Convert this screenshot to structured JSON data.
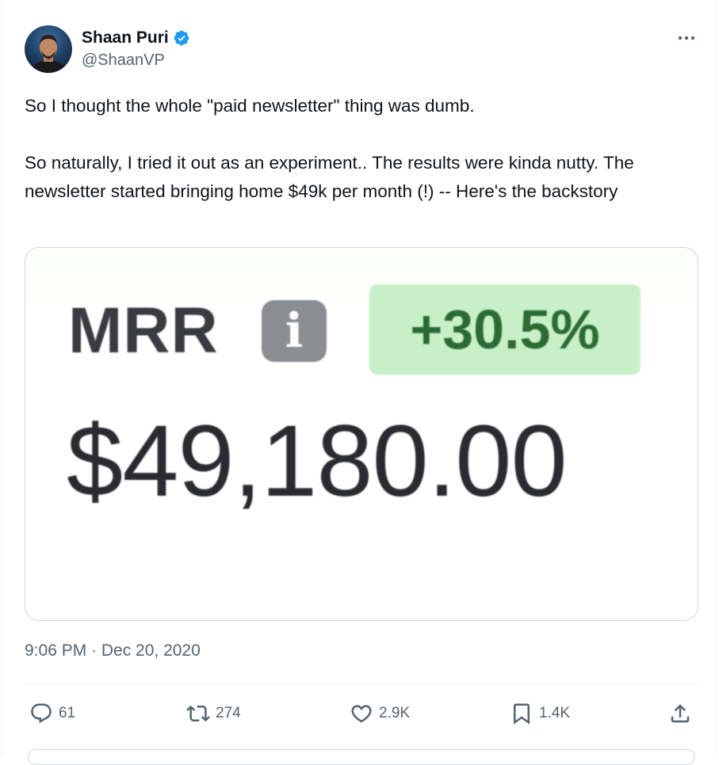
{
  "author": {
    "display_name": "Shaan Puri",
    "handle": "@ShaanVP",
    "verified": true,
    "verified_icon": "verified-badge-icon",
    "verified_color": "#1d9bf0"
  },
  "tweet": {
    "lines": [
      "So I thought the whole \"paid newsletter\" thing was dumb.",
      "So naturally, I tried it out as an experiment.. The results were kinda nutty. The newsletter started bringing home $49k per month (!) -- Here's the backstory"
    ],
    "timestamp": "9:06 PM · Dec 20, 2020"
  },
  "media": {
    "metric_label": "MRR",
    "info_icon": "info-icon",
    "info_glyph": "i",
    "growth": "+30.5%",
    "growth_color": "#c7f0c8",
    "value": "$49,180.00"
  },
  "actions": {
    "replies": "61",
    "retweets": "274",
    "likes": "2.9K",
    "bookmarks": "1.4K"
  },
  "colors": {
    "text_primary": "#0f1419",
    "text_secondary": "#536471",
    "border": "#cfd9de"
  }
}
